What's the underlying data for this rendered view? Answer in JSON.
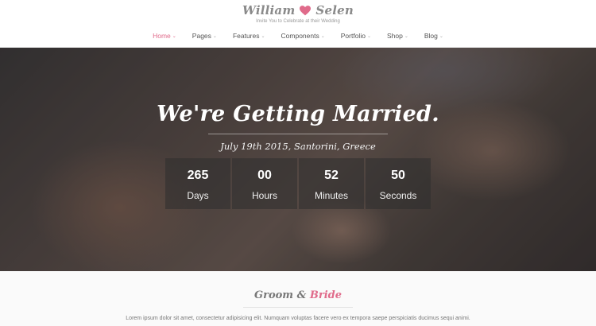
{
  "brand": {
    "groom": "William",
    "bride": "Selen",
    "tagline": "Invite You to Celebrate at their Wedding",
    "heart_color": "#e06b8b"
  },
  "nav": {
    "items": [
      {
        "label": "Home",
        "active": true
      },
      {
        "label": "Pages",
        "active": false
      },
      {
        "label": "Features",
        "active": false
      },
      {
        "label": "Components",
        "active": false
      },
      {
        "label": "Portfolio",
        "active": false
      },
      {
        "label": "Shop",
        "active": false
      },
      {
        "label": "Blog",
        "active": false
      }
    ]
  },
  "hero": {
    "title": "We're Getting Married.",
    "subtitle": "July 19th 2015, Santorini, Greece",
    "countdown": [
      {
        "value": "265",
        "label": "Days"
      },
      {
        "value": "00",
        "label": "Hours"
      },
      {
        "value": "52",
        "label": "Minutes"
      },
      {
        "value": "50",
        "label": "Seconds"
      }
    ]
  },
  "section": {
    "title_part1": "Groom",
    "title_amp": " & ",
    "title_part2": "Bride",
    "text": "Lorem ipsum dolor sit amet, consectetur adipisicing elit. Numquam voluptas facere vero ex tempora saepe perspiciatis ducimus sequi animi."
  },
  "colors": {
    "accent": "#e06b8b"
  }
}
